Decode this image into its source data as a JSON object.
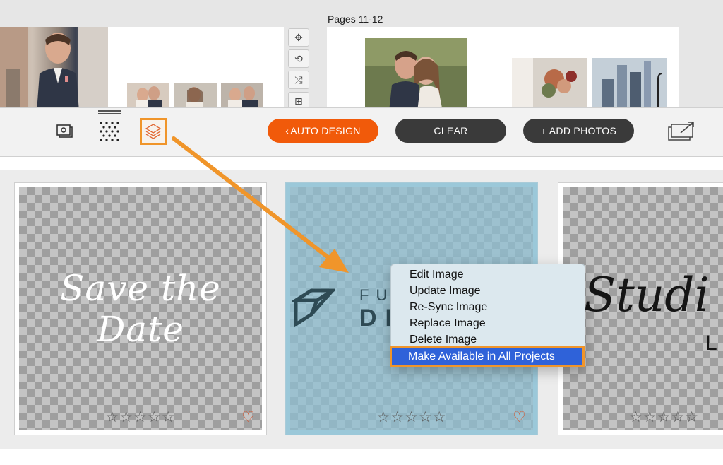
{
  "top_panel": {
    "pages_label": "Pages 11-12",
    "side_tools": [
      {
        "name": "move-icon",
        "glyph": "✥"
      },
      {
        "name": "rotate-icon",
        "glyph": "⟲"
      },
      {
        "name": "shuffle-icon",
        "glyph": "⤮"
      },
      {
        "name": "grid-layout-icon",
        "glyph": "⊞"
      }
    ]
  },
  "toolbar": {
    "auto_design_label": "AUTO DESIGN",
    "auto_design_chevron": "‹",
    "clear_label": "CLEAR",
    "add_photos_label": "+ ADD PHOTOS",
    "icons": [
      "photos-icon",
      "pattern-icon",
      "layers-icon",
      "export-icon"
    ]
  },
  "colors": {
    "accent_orange": "#f15a0a",
    "dark_pill": "#3a3a3a",
    "highlight_orange": "#f0952a",
    "menu_selection": "#2f62d9",
    "selected_card": "#bcd9e4"
  },
  "cards": [
    {
      "text": "Save the Date",
      "stars": "☆☆☆☆☆",
      "heart": "♡",
      "selected": false
    },
    {
      "text_line1": "FUN",
      "text_line2": "DE",
      "stars": "☆☆☆☆☆",
      "heart": "♡",
      "selected": true
    },
    {
      "text_line1": "Studi",
      "text_line2": "L",
      "stars": "☆☆☆☆☆",
      "selected": false
    }
  ],
  "context_menu": {
    "items": [
      "Edit Image",
      "Update Image",
      "Re-Sync Image",
      "Replace Image",
      "Delete Image"
    ],
    "highlighted_item": "Make Available in All Projects"
  }
}
